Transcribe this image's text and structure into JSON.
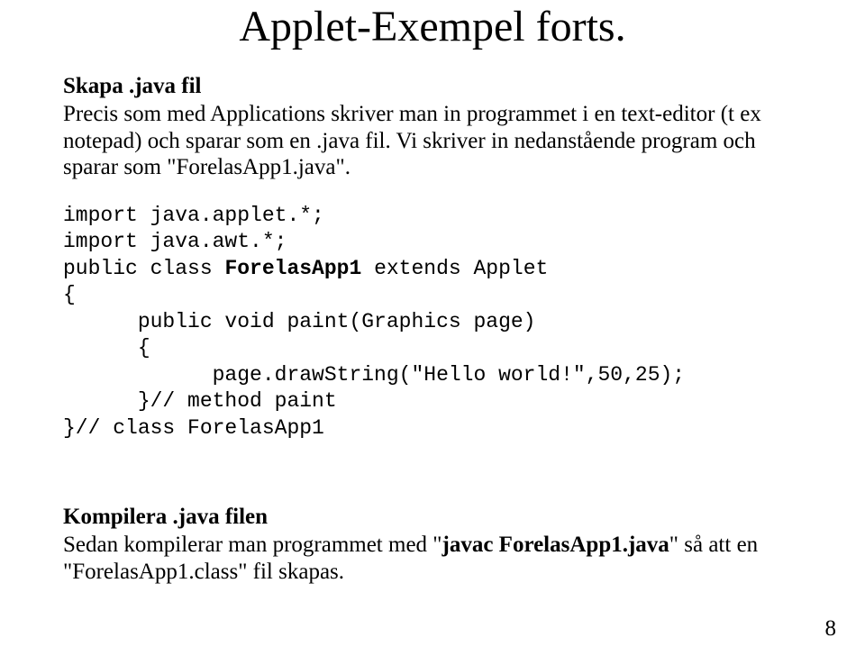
{
  "title": "Applet-Exempel forts.",
  "section1": {
    "heading": "Skapa .java fil",
    "body": "Precis som med Applications skriver man in programmet i en text-editor (t ex notepad) och sparar som en .java fil. Vi skriver in nedanstående program och sparar som \"ForelasApp1.java\"."
  },
  "code": {
    "l1": "import java.applet.*;",
    "l2": "import java.awt.*;",
    "l3a": "public class ",
    "l3b": "ForelasApp1",
    "l3c": " extends Applet",
    "l4": "{",
    "l5": "      public void paint(Graphics page)",
    "l6": "      {",
    "l7": "            page.drawString(\"Hello world!\",50,25);",
    "l8": "      }// method paint",
    "l9": "}// class ForelasApp1"
  },
  "section2": {
    "heading": "Kompilera .java filen",
    "body_pre": "Sedan kompilerar man programmet med \"",
    "body_bold": "javac ForelasApp1.java",
    "body_post": "\" så att en \"ForelasApp1.class\" fil skapas."
  },
  "page_number": "8"
}
